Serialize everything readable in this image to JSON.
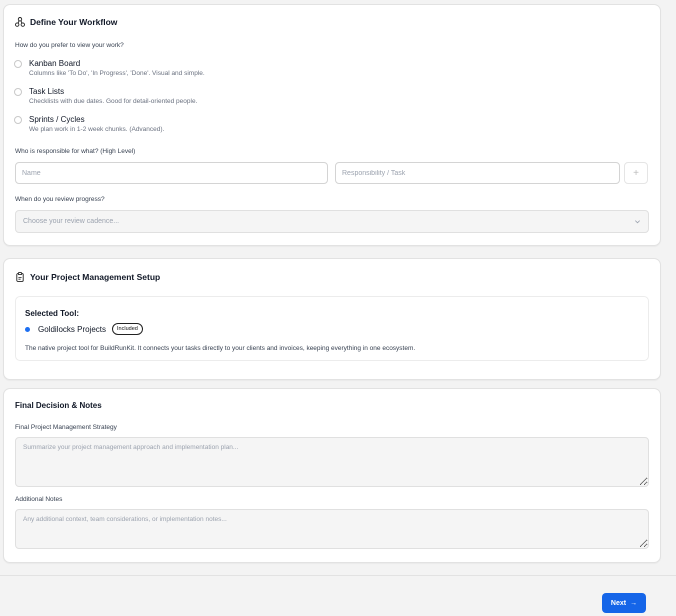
{
  "workflow": {
    "title": "Define Your Workflow",
    "view_question": "How do you prefer to view your work?",
    "view_options": [
      {
        "label": "Kanban Board",
        "description": "Columns like 'To Do', 'In Progress', 'Done'. Visual and simple."
      },
      {
        "label": "Task Lists",
        "description": "Checklists with due dates. Good for detail-oriented people."
      },
      {
        "label": "Sprints / Cycles",
        "description": "We plan work in 1-2 week chunks. (Advanced)."
      }
    ],
    "responsibility_question": "Who is responsible for what? (High Level)",
    "name_placeholder": "Name",
    "responsibility_placeholder": "Responsibility / Task",
    "add_label": "+",
    "review_question": "When do you review progress?",
    "review_placeholder": "Choose your review cadence..."
  },
  "setup": {
    "title": "Your Project Management Setup",
    "selected_label": "Selected Tool:",
    "tool_name": "Goldilocks Projects",
    "tool_badge": "Included",
    "tool_description": "The native project tool for BuildRunKit. It connects your tasks directly to your clients and invoices, keeping everything in one ecosystem.",
    "accent_color": "#1d6ff2"
  },
  "final": {
    "title": "Final Decision & Notes",
    "strategy_label": "Final Project Management Strategy",
    "strategy_placeholder": "Summarize your project management approach and implementation plan...",
    "notes_label": "Additional Notes",
    "notes_placeholder": "Any additional context, team considerations, or implementation notes..."
  },
  "footer": {
    "next_label": "Next",
    "next_arrow": "→",
    "button_color": "#1565e8"
  },
  "icons": {
    "workflow": "workflow-icon",
    "setup": "clipboard-icon",
    "select": "chevron-down-icon"
  }
}
